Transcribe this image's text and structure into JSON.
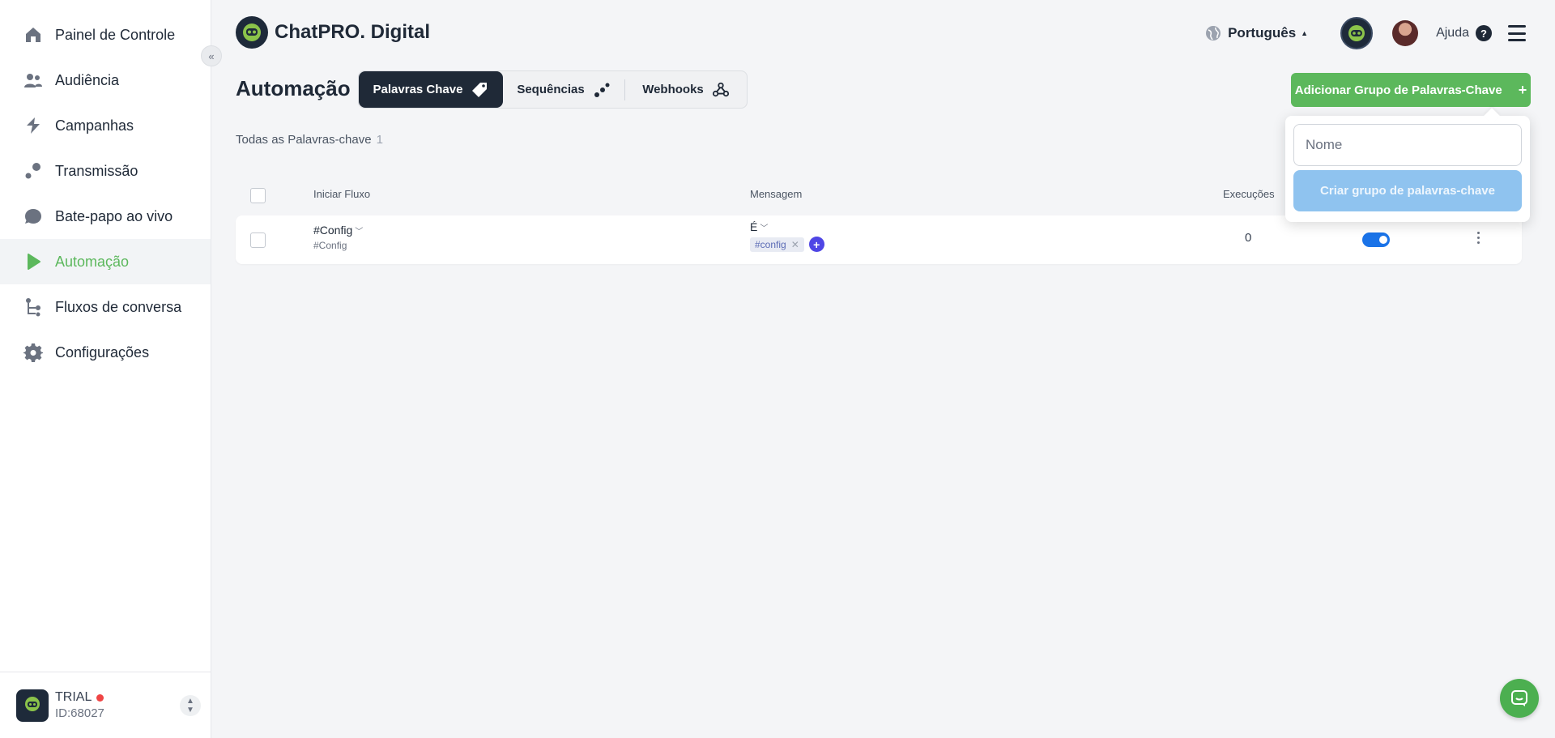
{
  "sidebar": {
    "items": [
      {
        "label": "Painel de Controle",
        "icon": "home-icon"
      },
      {
        "label": "Audiência",
        "icon": "users-icon"
      },
      {
        "label": "Campanhas",
        "icon": "campaign-icon"
      },
      {
        "label": "Transmissão",
        "icon": "broadcast-icon"
      },
      {
        "label": "Bate-papo ao vivo",
        "icon": "chat-icon"
      },
      {
        "label": "Automação",
        "icon": "automation-icon",
        "active": true
      },
      {
        "label": "Fluxos de conversa",
        "icon": "flow-icon"
      },
      {
        "label": "Configurações",
        "icon": "settings-icon"
      }
    ],
    "account": {
      "plan": "TRIAL",
      "id": "ID:68027"
    }
  },
  "header": {
    "brand": "ChatPRO. Digital",
    "language": "Português",
    "help": "Ajuda"
  },
  "page": {
    "title": "Automação",
    "tabs": [
      {
        "label": "Palavras Chave",
        "active": true
      },
      {
        "label": "Sequências"
      },
      {
        "label": "Webhooks"
      }
    ],
    "add_group_label": "Adicionar Grupo de Palavras-Chave",
    "all_keywords_label": "Todas as Palavras-chave",
    "all_keywords_count": "1"
  },
  "table": {
    "columns": {
      "flow": "Iniciar Fluxo",
      "message": "Mensagem",
      "runs": "Execuções"
    },
    "rows": [
      {
        "flow": "#Config",
        "flow_sub": "#Config",
        "condition": "É",
        "tag": "#config",
        "runs": "0",
        "enabled": true
      }
    ]
  },
  "popup": {
    "name_placeholder": "Nome",
    "create_label": "Criar grupo de palavras-chave"
  },
  "colors": {
    "accent_green": "#5cb85c",
    "dark": "#1f2937",
    "toggle_blue": "#1a73e8",
    "create_btn": "#8fc3ef"
  }
}
